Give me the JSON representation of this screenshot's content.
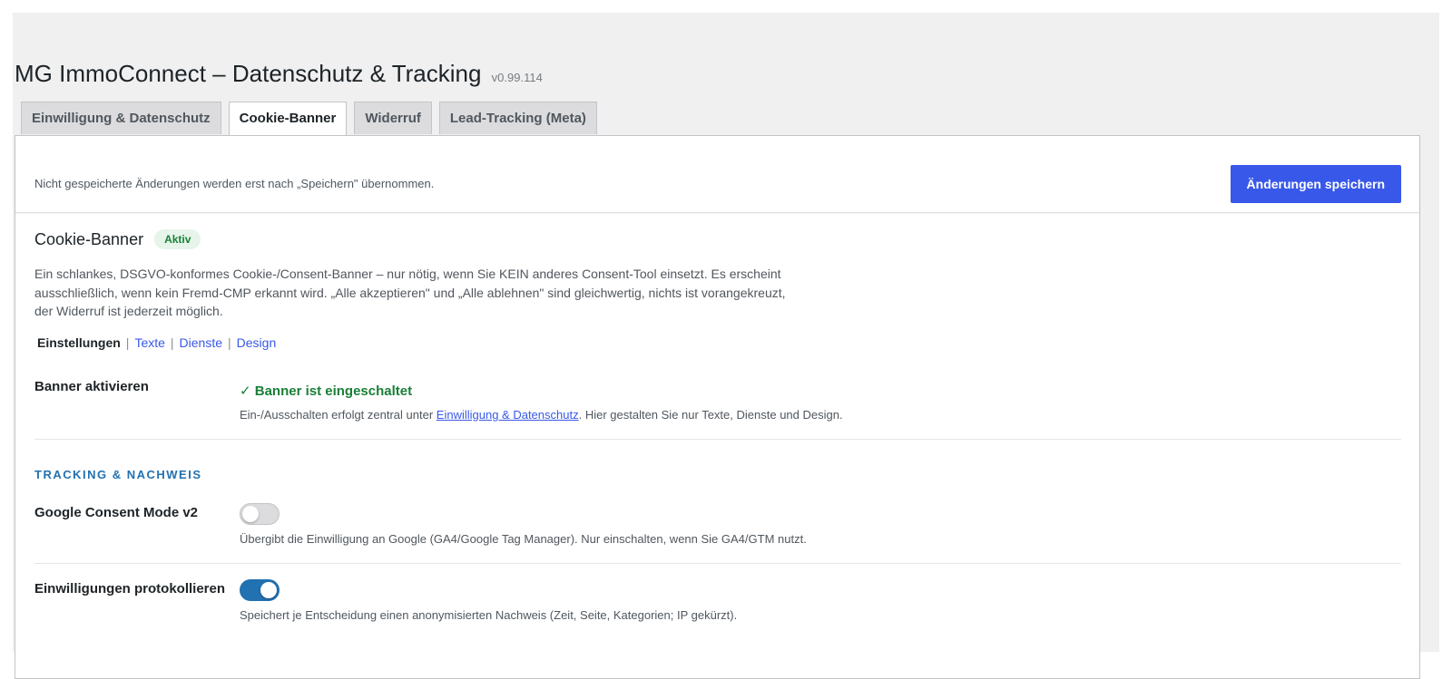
{
  "page": {
    "title": "MG ImmoConnect – Datenschutz & Tracking",
    "version": "v0.99.114"
  },
  "tabs": [
    {
      "label": "Einwilligung & Datenschutz",
      "active": false
    },
    {
      "label": "Cookie-Banner",
      "active": true
    },
    {
      "label": "Widerruf",
      "active": false
    },
    {
      "label": "Lead-Tracking (Meta)",
      "active": false
    }
  ],
  "savebar": {
    "note": "Nicht gespeicherte Änderungen werden erst nach „Speichern\" übernommen.",
    "save_label": "Änderungen speichern"
  },
  "section": {
    "title": "Cookie-Banner",
    "badge": "Aktiv",
    "description": "Ein schlankes, DSGVO-konformes Cookie-/Consent-Banner – nur nötig, wenn Sie KEIN anderes Consent-Tool einsetzt. Es erscheint ausschließlich, wenn kein Fremd-CMP erkannt wird. „Alle akzeptieren\" und „Alle ablehnen\" sind gleichwertig, nichts ist vorangekreuzt, der Widerruf ist jederzeit möglich."
  },
  "subnav": {
    "current": "Einstellungen",
    "links": [
      "Texte",
      "Dienste",
      "Design"
    ]
  },
  "banner_row": {
    "label": "Banner aktivieren",
    "status": "✓ Banner ist eingeschaltet",
    "help_before": "Ein-/Ausschalten erfolgt zentral unter ",
    "help_link": "Einwilligung & Datenschutz",
    "help_after": ". Hier gestalten Sie nur Texte, Dienste und Design."
  },
  "tracking": {
    "heading": "TRACKING & NACHWEIS",
    "settings": [
      {
        "label": "Google Consent Mode v2",
        "enabled": false,
        "help": "Übergibt die Einwilligung an Google (GA4/Google Tag Manager). Nur einschalten, wenn Sie GA4/GTM nutzt."
      },
      {
        "label": "Einwilligungen protokollieren",
        "enabled": true,
        "help": "Speichert je Entscheidung einen anonymisierten Nachweis (Zeit, Seite, Kategorien; IP gekürzt)."
      }
    ]
  },
  "colors": {
    "accent": "#3858e9",
    "success": "#1a7f37",
    "toggle_on": "#2271b1",
    "heading_blue": "#2271b1"
  }
}
